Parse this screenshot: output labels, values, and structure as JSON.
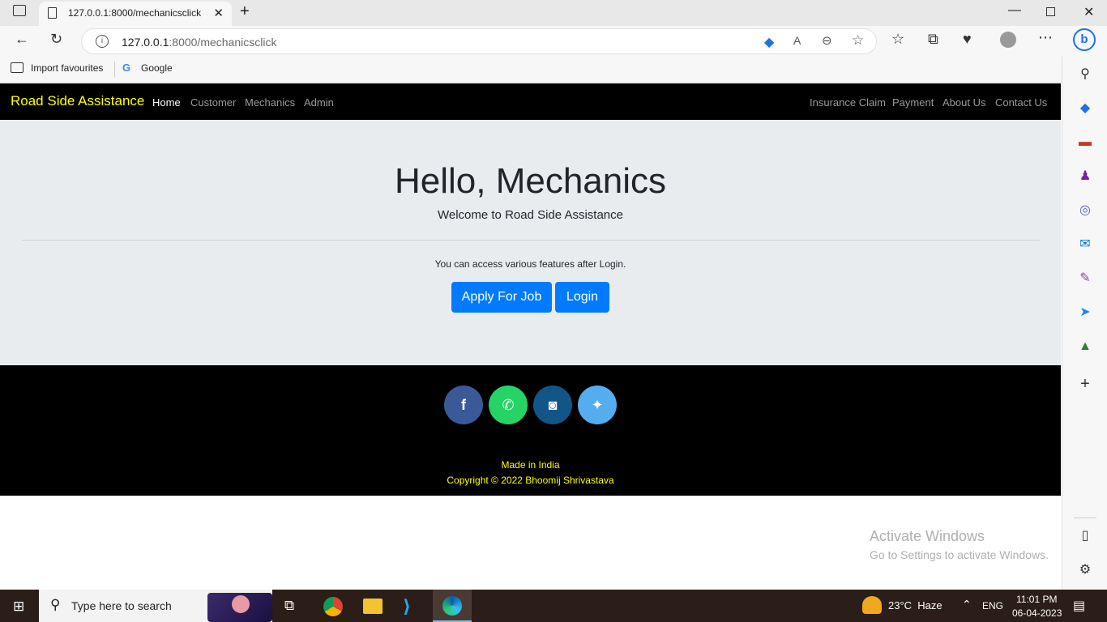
{
  "browser": {
    "tab_title": "127.0.0.1:8000/mechanicsclick",
    "url_host": "127.0.0.1",
    "url_path": ":8000/mechanicsclick",
    "favourites": [
      "Import favourites",
      "Google"
    ]
  },
  "site": {
    "brand": "Road Side Assistance",
    "nav_left": [
      "Home",
      "Customer",
      "Mechanics",
      "Admin"
    ],
    "nav_right": [
      "Insurance Claim",
      "Payment",
      "About Us",
      "Contact Us"
    ],
    "hero": {
      "title": "Hello, Mechanics",
      "subtitle": "Welcome to Road Side Assistance",
      "note": "You can access various features after Login.",
      "apply_button": "Apply For Job",
      "login_button": "Login"
    },
    "footer": {
      "made_in": "Made in India",
      "copyright": "Copyright © 2022 Bhoomij Shrivastava"
    },
    "social_colors": {
      "facebook": "#3b5998",
      "whatsapp": "#25d366",
      "instagram": "#125688",
      "twitter": "#55acee"
    }
  },
  "watermark": {
    "line1": "Activate Windows",
    "line2": "Go to Settings to activate Windows."
  },
  "taskbar": {
    "search_placeholder": "Type here to search",
    "weather": "23°C  Haze",
    "language": "ENG",
    "time": "11:01 PM",
    "date": "06-04-2023"
  }
}
